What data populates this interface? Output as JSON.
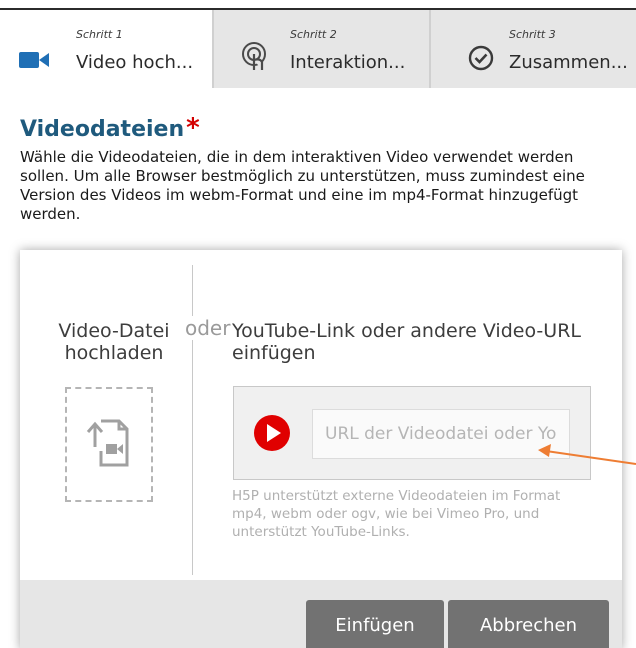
{
  "steps": [
    {
      "number": "Schritt 1",
      "label": "Video hoch...",
      "icon": "video-camera-icon",
      "active": true
    },
    {
      "number": "Schritt 2",
      "label": "Interaktion...",
      "icon": "touch-icon",
      "active": false
    },
    {
      "number": "Schritt 3",
      "label": "Zusammen...",
      "icon": "check-circle-icon",
      "active": false
    }
  ],
  "section": {
    "title": "Videodateien",
    "required_marker": "*",
    "description": "Wähle die Videodateien, die in dem interaktiven Video verwendet werden sollen. Um alle Browser bestmöglich zu unterstützen, muss zumindest eine Version des Videos im webm-Format und eine im mp4-Format hinzugefügt werden."
  },
  "dialog": {
    "upload_title": "Video-Datei hochladen",
    "upload_icon": "file-upload-video-icon",
    "separator": "oder",
    "url_title": "YouTube-Link oder andere Video-URL einfügen",
    "url_icon": "youtube-play-icon",
    "url_placeholder": "URL der Videodatei oder YouTube-Link",
    "url_value": "",
    "hint": "H5P unterstützt externe Videodateien im Format mp4, webm oder ogv, wie bei Vimeo Pro, und unterstützt YouTube-Links.",
    "insert_label": "Einfügen",
    "cancel_label": "Abbrechen"
  },
  "colors": {
    "title": "#1f5a7d",
    "required": "#d40000",
    "video_icon": "#1f6fb5",
    "youtube_red": "#e00000",
    "button": "#727272",
    "annotation_arrow": "#ee7d33"
  }
}
